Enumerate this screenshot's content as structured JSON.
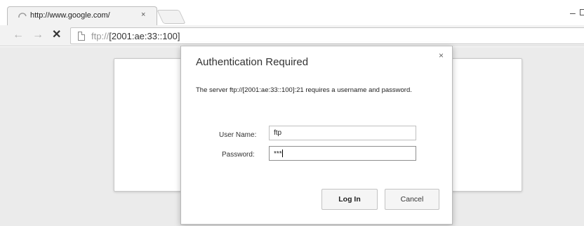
{
  "browser": {
    "tab": {
      "title": "http://www.google.com/",
      "close_glyph": "×",
      "favicon": "loading-spinner-icon"
    },
    "window_controls": {
      "minimize_glyph": "–"
    },
    "toolbar": {
      "back_glyph": "←",
      "forward_glyph": "→",
      "stop_glyph": "✕",
      "address": {
        "scheme": "ftp://",
        "host": "[2001:ae:33::100]"
      }
    }
  },
  "dialog": {
    "title": "Authentication Required",
    "close_glyph": "×",
    "message": "The server ftp://[2001:ae:33::100]:21 requires a username and password.",
    "username_label": "User Name:",
    "username_value": "ftp",
    "password_label": "Password:",
    "password_value": "***",
    "login_label": "Log In",
    "cancel_label": "Cancel"
  },
  "colors": {
    "content_background": "#ebebeb",
    "toolbar_background": "#f2f2f2",
    "dialog_background": "#ffffff"
  }
}
